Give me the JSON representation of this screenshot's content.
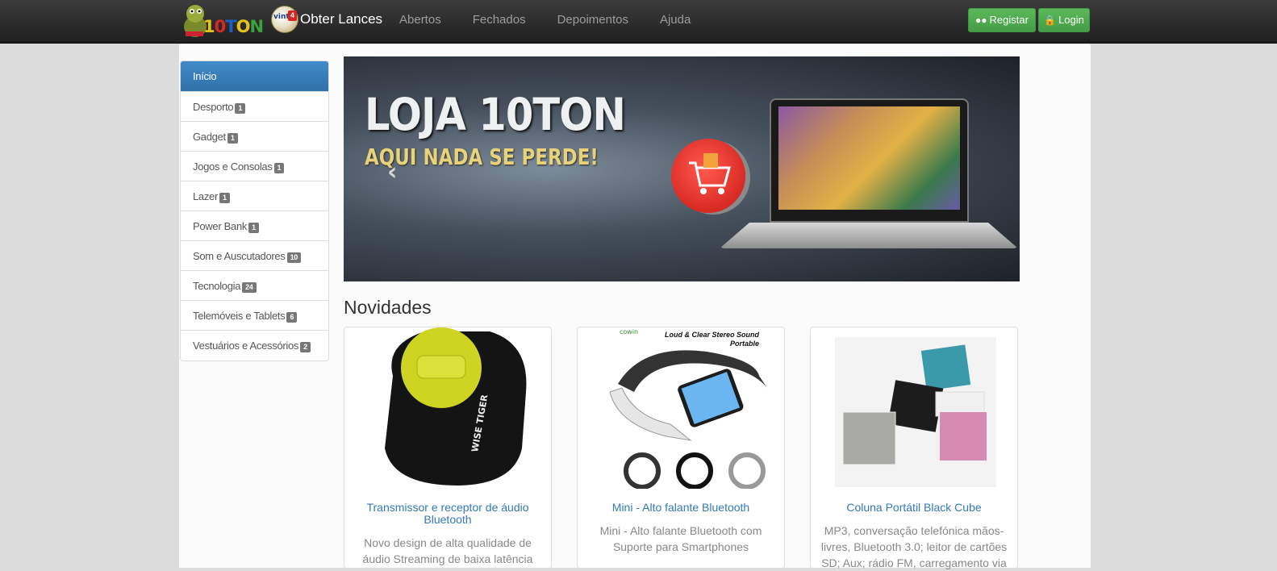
{
  "navbar": {
    "logo_text": "10TON",
    "brand_label": "Obter Lances",
    "brand_badge": "vint",
    "brand_badge_num": "4",
    "links": [
      "Abertos",
      "Fechados",
      "Depoimentos",
      "Ajuda"
    ],
    "register_label": "Registar",
    "login_label": "Login",
    "accent_color": "#5cb85c"
  },
  "sidebar": {
    "items": [
      {
        "label": "Início",
        "count": null,
        "active": true
      },
      {
        "label": "Desporto",
        "count": "1"
      },
      {
        "label": "Gadget",
        "count": "1"
      },
      {
        "label": "Jogos e Consolas",
        "count": "1"
      },
      {
        "label": "Lazer",
        "count": "1"
      },
      {
        "label": "Power Bank",
        "count": "1"
      },
      {
        "label": "Som e Auscutadores",
        "count": "10"
      },
      {
        "label": "Tecnologia",
        "count": "24"
      },
      {
        "label": "Telemóveis e Tablets",
        "count": "6"
      },
      {
        "label": "Vestuários e Acessórios",
        "count": "2"
      }
    ]
  },
  "banner": {
    "title": "LOJA 10TON",
    "subtitle": "AQUI NADA SE PERDE!"
  },
  "section": {
    "title": "Novidades"
  },
  "products": [
    {
      "title": "Transmissor e receptor de áudio Bluetooth",
      "description": "Novo design de alta qualidade de áudio Streaming de baixa latência",
      "image_brand": "WISE TIGER"
    },
    {
      "title": "Mini - Alto falante Bluetooth",
      "description": "Mini - Alto falante Bluetooth com Suporte para Smartphones",
      "image_tagline": "Loud & Clear Stereo Sound Portable",
      "image_brand": "cowin"
    },
    {
      "title": "Coluna Portátil Black Cube",
      "description": "MP3, conversação telefónica mãos-livres, Bluetooth 3.0; leitor de cartões SD; Aux; rádio FM, carregamento via"
    }
  ]
}
